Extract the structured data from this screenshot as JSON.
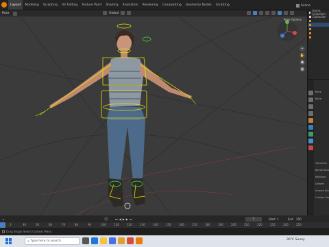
{
  "app": {
    "logo_icon": "blender-logo-icon"
  },
  "workspaces": [
    "Layout",
    "Modeling",
    "Sculpting",
    "UV Editing",
    "Texture Paint",
    "Shading",
    "Animation",
    "Rendering",
    "Compositing",
    "Geometry Nodes",
    "Scripting"
  ],
  "active_workspace": "Layout",
  "scene": {
    "label": "Scene"
  },
  "header": {
    "mode": "Pose",
    "pivot": "Global",
    "pose_options": "Pose Options"
  },
  "outliner": {
    "rows": [
      "Scene Collection",
      "Collection",
      "",
      "",
      "",
      "",
      ""
    ]
  },
  "properties": {
    "rows": [
      "Bone",
      "Bone",
      "Transform",
      "Bendy Bones",
      "Relations",
      "Deform",
      "Inverse Kinematics",
      "Custom Props"
    ]
  },
  "timeline": {
    "current_frame": "1",
    "start_label": "Start",
    "start": "1",
    "end_label": "End",
    "end": "250"
  },
  "ruler": {
    "ticks": [
      "0",
      "40",
      "50",
      "60",
      "70",
      "80",
      "90",
      "100",
      "110",
      "120",
      "130",
      "140",
      "150",
      "160",
      "170",
      "180",
      "190",
      "200",
      "210",
      "220",
      "230",
      "240",
      "250"
    ]
  },
  "status": {
    "text": "Drag  Shape  Select  Context Menu"
  },
  "taskbar": {
    "search_placeholder": "Type here to search",
    "weather": "30°C Sunny",
    "time": "Sunny"
  },
  "colors": {
    "viewport_bg": "#3b3b3b",
    "accent": "#4a7fc1",
    "rig": "#e6e400",
    "green": "#40c040"
  }
}
